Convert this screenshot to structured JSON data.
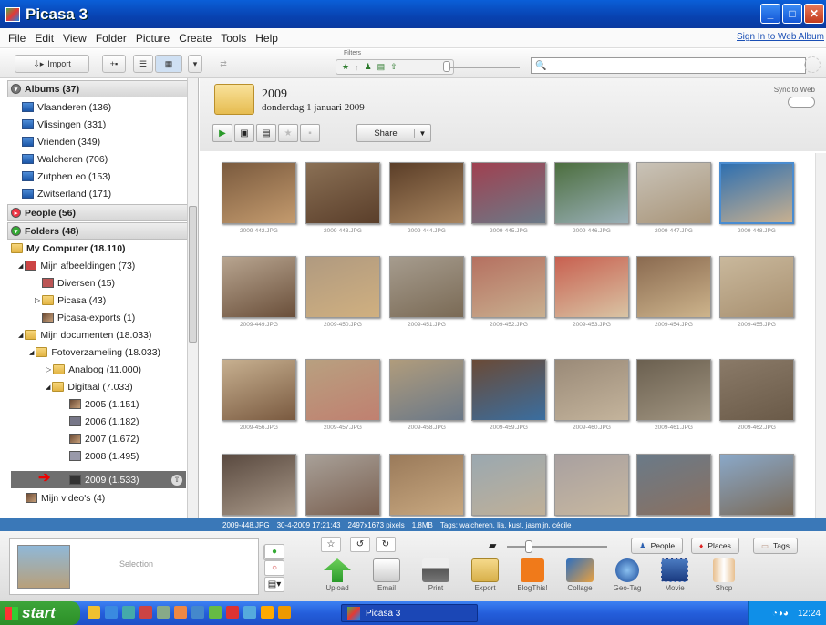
{
  "window": {
    "title": "Picasa 3"
  },
  "menu": {
    "items": [
      "File",
      "Edit",
      "View",
      "Folder",
      "Picture",
      "Create",
      "Tools",
      "Help"
    ],
    "signin": "Sign In to Web Album"
  },
  "toolbar": {
    "import_label": "Import",
    "filters_label": "Filters"
  },
  "sidebar": {
    "albums_header": "Albums (37)",
    "albums": [
      "Vlaanderen (136)",
      "Vlissingen (331)",
      "Vrienden (349)",
      "Walcheren (706)",
      "Zutphen eo (153)",
      "Zwitserland (171)"
    ],
    "people_header": "People (56)",
    "folders_header": "Folders (48)",
    "tree": {
      "my_computer": "My Computer (18.110)",
      "mijn_afbeeldingen": "Mijn afbeeldingen (73)",
      "diversen": "Diversen (15)",
      "picasa": "Picasa (43)",
      "picasa_exports": "Picasa-exports (1)",
      "mijn_documenten": "Mijn documenten (18.033)",
      "fotoverzameling": "Fotoverzameling (18.033)",
      "analoog": "Analoog (11.000)",
      "digitaal": "Digitaal (7.033)",
      "y2005": "2005 (1.151)",
      "y2006": "2006 (1.182)",
      "y2007": "2007 (1.672)",
      "y2008": "2008 (1.495)",
      "y2009": "2009 (1.533)",
      "videos": "Mijn video's (4)"
    }
  },
  "folder_header": {
    "title": "2009",
    "date": "donderdag 1 januari 2009",
    "sync_label": "Sync to Web",
    "share_label": "Share"
  },
  "photos": [
    {
      "caption": "2009-442.JPG",
      "colors": [
        "#7a5a3e",
        "#c49b6e"
      ]
    },
    {
      "caption": "2009-443.JPG",
      "colors": [
        "#8a7055",
        "#5a3e2a"
      ]
    },
    {
      "caption": "2009-444.JPG",
      "colors": [
        "#5b3e28",
        "#a98660"
      ]
    },
    {
      "caption": "2009-445.JPG",
      "colors": [
        "#a04050",
        "#6b7a88"
      ]
    },
    {
      "caption": "2009-446.JPG",
      "colors": [
        "#4c6e3e",
        "#9ab0b8"
      ]
    },
    {
      "caption": "2009-447.JPG",
      "colors": [
        "#c9c3b8",
        "#a89478"
      ]
    },
    {
      "caption": "2009-448.JPG",
      "colors": [
        "#2e6fb0",
        "#c8b090"
      ],
      "selected": true
    },
    {
      "caption": "2009-449.JPG",
      "colors": [
        "#b8a590",
        "#6a4f3a"
      ]
    },
    {
      "caption": "2009-450.JPG",
      "colors": [
        "#b09a80",
        "#d0b080"
      ]
    },
    {
      "caption": "2009-451.JPG",
      "colors": [
        "#a69c8e",
        "#7a6a55"
      ]
    },
    {
      "caption": "2009-452.JPG",
      "colors": [
        "#b57060",
        "#c9b090"
      ]
    },
    {
      "caption": "2009-453.JPG",
      "colors": [
        "#c86050",
        "#d9c4a4"
      ]
    },
    {
      "caption": "2009-454.JPG",
      "colors": [
        "#8a6a50",
        "#cdb48c"
      ]
    },
    {
      "caption": "2009-455.JPG",
      "colors": [
        "#c9b89c",
        "#a89070"
      ]
    },
    {
      "caption": "2009-456.JPG",
      "colors": [
        "#c7b090",
        "#7a5a40"
      ]
    },
    {
      "caption": "2009-457.JPG",
      "colors": [
        "#b8a080",
        "#c08070"
      ]
    },
    {
      "caption": "2009-458.JPG",
      "colors": [
        "#b09c7c",
        "#6a7888"
      ]
    },
    {
      "caption": "2009-459.JPG",
      "colors": [
        "#6a4a36",
        "#3a6ea0"
      ]
    },
    {
      "caption": "2009-460.JPG",
      "colors": [
        "#9a8a78",
        "#c4b49c"
      ]
    },
    {
      "caption": "2009-461.JPG",
      "colors": [
        "#6b6050",
        "#a09480"
      ]
    },
    {
      "caption": "2009-462.JPG",
      "colors": [
        "#8a7a68",
        "#6a5a48"
      ]
    },
    {
      "caption": "",
      "colors": [
        "#5a4a40",
        "#a89888"
      ]
    },
    {
      "caption": "",
      "colors": [
        "#a8a098",
        "#7a6050"
      ]
    },
    {
      "caption": "",
      "colors": [
        "#9a7a5a",
        "#c8a880"
      ]
    },
    {
      "caption": "",
      "colors": [
        "#9aa8b0",
        "#c0b098"
      ]
    },
    {
      "caption": "",
      "colors": [
        "#a8a0a0",
        "#c8b8a0"
      ]
    },
    {
      "caption": "",
      "colors": [
        "#6a7a88",
        "#8a7060"
      ]
    },
    {
      "caption": "",
      "colors": [
        "#8aa8c8",
        "#7a6a58"
      ]
    }
  ],
  "status": {
    "file": "2009-448.JPG",
    "datetime": "30-4-2009 17:21:43",
    "size": "2497x1673 pixels",
    "bytes": "1,8MB",
    "tags": "Tags: walcheren, lia, kust, jasmijn, cécile"
  },
  "bottom": {
    "selection_label": "Selection",
    "actions": [
      "Upload",
      "Email",
      "Print",
      "Export",
      "BlogThis!",
      "Collage",
      "Geo-Tag",
      "Movie",
      "Shop"
    ],
    "people": "People",
    "places": "Places",
    "tags": "Tags"
  },
  "taskbar": {
    "start": "start",
    "task": "Picasa 3",
    "clock": "12:24"
  }
}
